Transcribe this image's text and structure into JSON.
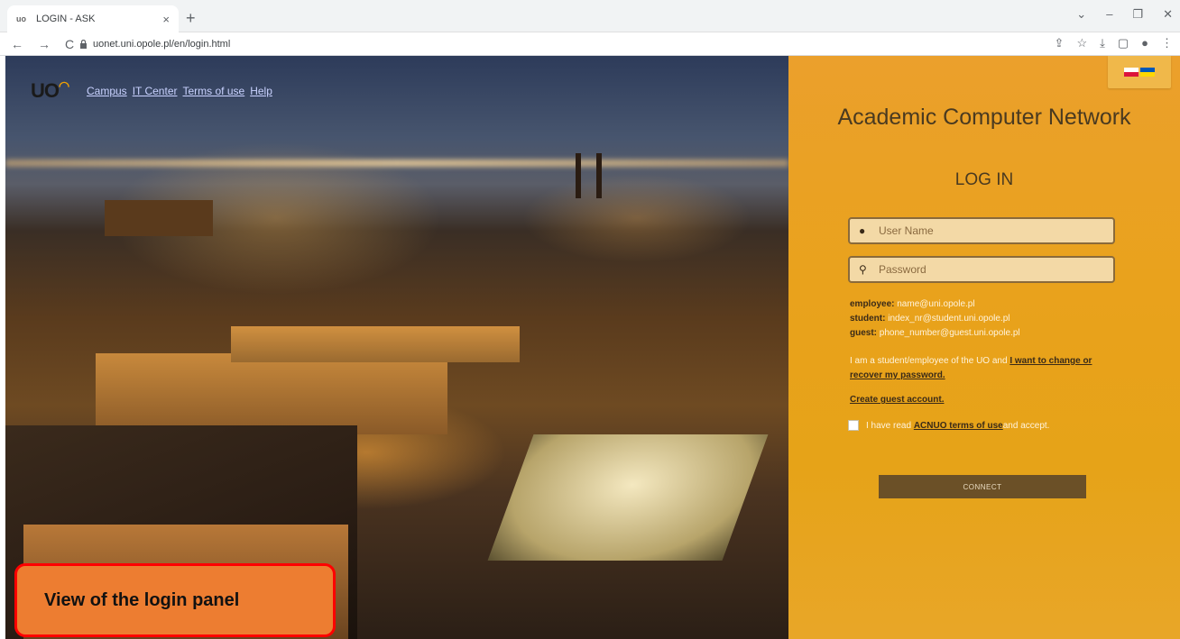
{
  "browser": {
    "tab_title": "LOGIN - ASK",
    "tab_favicon": "uo",
    "tab_close": "×",
    "new_tab": "+",
    "url": "uonet.uni.opole.pl/en/login.html",
    "nav": {
      "back": "←",
      "forward": "→",
      "reload": "C"
    },
    "window_controls": {
      "dropdown": "⌄",
      "minimize": "–",
      "restore": "❐",
      "close": "✕"
    },
    "toolbar_icons": {
      "share": "⇪",
      "bookmark": "☆",
      "download": "⤓",
      "sidebar": "▢",
      "profile": "●",
      "menu": "⋮"
    }
  },
  "site": {
    "logo": "UO",
    "nav": [
      "Campus",
      "IT Center",
      "Terms of use",
      "Help"
    ]
  },
  "callout": {
    "text": "View of the login panel"
  },
  "panel": {
    "title": "Academic Computer Network",
    "login_heading": "LOG IN",
    "username_placeholder": "User Name",
    "password_placeholder": "Password",
    "username_icon": "user-icon",
    "password_icon": "key-icon",
    "hints": [
      {
        "label": "employee:",
        "value": " name@uni.opole.pl"
      },
      {
        "label": "student:",
        "value": " index_nr@student.uni.opole.pl"
      },
      {
        "label": "guest:",
        "value": " phone_number@guest.uni.opole.pl"
      }
    ],
    "pw_note_prefix": "I am a student/employee of the UO and ",
    "pw_note_link": "I want to change or recover my password.",
    "guest_link": "Create guest account.",
    "accept_prefix": "I have read ",
    "accept_link": "ACNUO terms of use",
    "accept_suffix": " and accept.",
    "accept_checked": false,
    "connect_label": "CONNECT"
  },
  "colors": {
    "panel_orange": "#e9a21c",
    "connect_button": "#6b5027",
    "callout_fill": "#ed7d31",
    "callout_border": "#ff0000"
  }
}
